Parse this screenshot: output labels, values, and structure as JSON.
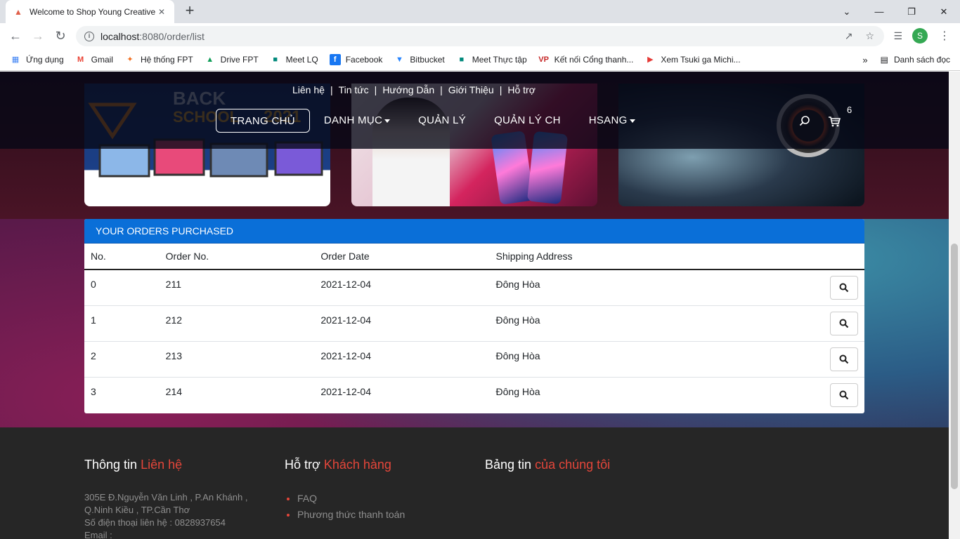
{
  "browser": {
    "tab_title": "Welcome to Shop Young Creative",
    "url_host": "localhost",
    "url_path": ":8080/order/list",
    "profile_initial": "S",
    "bookmarks": [
      {
        "label": "Ứng dụng",
        "icon": "apps-grid-icon"
      },
      {
        "label": "Gmail",
        "icon": "gmail-icon"
      },
      {
        "label": "Hệ thống FPT",
        "icon": "fpt-icon"
      },
      {
        "label": "Drive FPT",
        "icon": "drive-icon"
      },
      {
        "label": "Meet LQ",
        "icon": "meet-icon"
      },
      {
        "label": "Facebook",
        "icon": "facebook-icon"
      },
      {
        "label": "Bitbucket",
        "icon": "bitbucket-icon"
      },
      {
        "label": "Meet Thực tập",
        "icon": "meet-icon"
      },
      {
        "label": "Kết nối Cổng thanh...",
        "icon": "vp-icon"
      },
      {
        "label": "Xem Tsuki ga Michi...",
        "icon": "play-icon"
      }
    ],
    "reading_list": "Danh sách đọc"
  },
  "topnav": [
    "Liên hệ",
    "Tin tức",
    "Hướng Dẫn",
    "Giới Thiệu",
    "Hỗ trợ"
  ],
  "mainnav": {
    "home": "TRANG CHỦ",
    "category": "DANH MỤC",
    "manage": "QUẢN LÝ",
    "manage_store": "QUẢN LÝ CH",
    "user": "HSANG"
  },
  "cart_count": "6",
  "orders": {
    "title": "YOUR ORDERS PURCHASED",
    "columns": [
      "No.",
      "Order No.",
      "Order Date",
      "Shipping Address"
    ],
    "rows": [
      {
        "no": "0",
        "order": "211",
        "date": "2021-12-04",
        "address": "Đông Hòa"
      },
      {
        "no": "1",
        "order": "212",
        "date": "2021-12-04",
        "address": "Đông Hòa"
      },
      {
        "no": "2",
        "order": "213",
        "date": "2021-12-04",
        "address": "Đông Hòa"
      },
      {
        "no": "3",
        "order": "214",
        "date": "2021-12-04",
        "address": "Đông Hòa"
      }
    ]
  },
  "footer": {
    "contact": {
      "title_a": "Thông tin ",
      "title_b": "Liên hệ",
      "line1": "305E Đ.Nguyễn Văn Linh , P.An Khánh ,",
      "line2": "Q.Ninh Kiều , TP.Cần Thơ",
      "line3": "Số điện thoại liên hệ : 0828937654",
      "line4": "Email :"
    },
    "support": {
      "title_a": "Hỗ trợ ",
      "title_b": "Khách hàng",
      "items": [
        "FAQ",
        "Phương thức thanh toán"
      ]
    },
    "news": {
      "title_a": "Bảng tin ",
      "title_b": "của chúng tôi"
    }
  },
  "colors": {
    "accent": "#e4463a",
    "header_blue": "#0a6fd8",
    "footer_bg": "#262626"
  }
}
